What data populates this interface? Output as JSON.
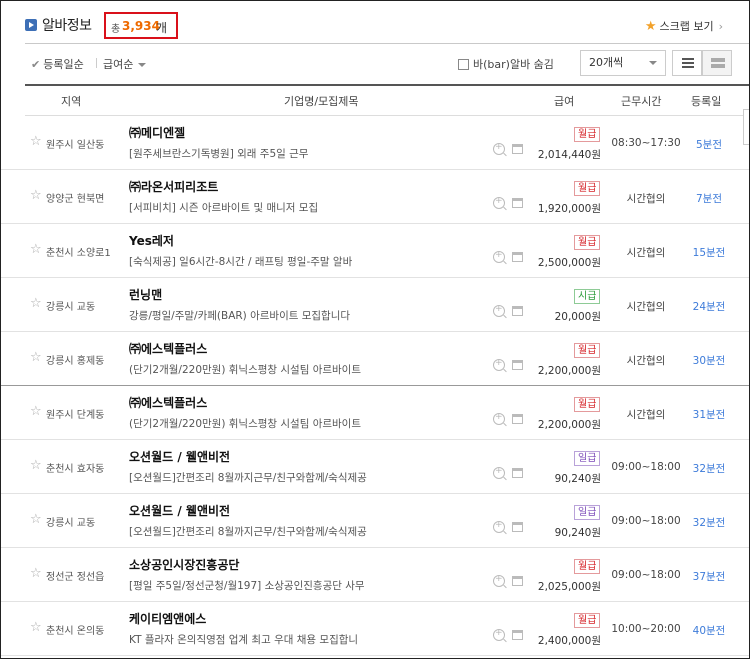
{
  "header": {
    "title": "알바정보",
    "count_prefix": "총",
    "count": "3,934",
    "count_unit": "개",
    "scrap_label": "스크랩 보기"
  },
  "toolbar": {
    "sort_registered": "등록일순",
    "sort_pay": "급여순",
    "bar_hide_label": "바(bar)알바 숨김",
    "per_page": "20개씩"
  },
  "columns": {
    "region": "지역",
    "company_title": "기업명/모집제목",
    "pay": "급여",
    "work_time": "근무시간",
    "registered": "등록일"
  },
  "pay_colors": {
    "월급": "#d6262b",
    "시급": "#2a9b39",
    "일급": "#7c4bb8"
  },
  "rows": [
    {
      "location": "원주시 일산동",
      "company": "㈜메디엔젤",
      "title": "[원주세브란스기독병원] 외래 주5일 근무",
      "pay_type": "월급",
      "pay_kind": "month",
      "pay": "2,014,440원",
      "time": "08:30~17:30",
      "date": "5분전"
    },
    {
      "location": "양양군 현북면",
      "company": "㈜라온서피리조트",
      "title": "[서피비치] 시즌 아르바이트 및 매니저 모집",
      "pay_type": "월급",
      "pay_kind": "month",
      "pay": "1,920,000원",
      "time": "시간협의",
      "date": "7분전"
    },
    {
      "location": "춘천시 소양로1",
      "company": "Yes레저",
      "title": "[숙식제공] 일6시간-8시간 / 래프팅 평일-주말 알바",
      "pay_type": "월급",
      "pay_kind": "month",
      "pay": "2,500,000원",
      "time": "시간협의",
      "date": "15분전"
    },
    {
      "location": "강릉시 교동",
      "company": "런닝맨",
      "title": "강릉/평일/주말/카페(BAR) 아르바이트 모집합니다",
      "pay_type": "시급",
      "pay_kind": "hour",
      "pay": "20,000원",
      "time": "시간협의",
      "date": "24분전"
    },
    {
      "location": "강릉시 홍제동",
      "company": "㈜에스텍플러스",
      "title": "(단기2개월/220만원) 휘닉스평창 시설팀 아르바이트",
      "pay_type": "월급",
      "pay_kind": "month",
      "pay": "2,200,000원",
      "time": "시간협의",
      "date": "30분전"
    },
    {
      "location": "원주시 단계동",
      "company": "㈜에스텍플러스",
      "title": "(단기2개월/220만원) 휘닉스평창 시설팀 아르바이트",
      "pay_type": "월급",
      "pay_kind": "month",
      "pay": "2,200,000원",
      "time": "시간협의",
      "date": "31분전"
    },
    {
      "location": "춘천시 효자동",
      "company": "오션월드 / 웰앤비전",
      "title": "[오션월드]간편조리 8월까지근무/친구와함께/숙식제공",
      "pay_type": "일급",
      "pay_kind": "day",
      "pay": "90,240원",
      "time": "09:00~18:00",
      "date": "32분전"
    },
    {
      "location": "강릉시 교동",
      "company": "오션월드 / 웰앤비전",
      "title": "[오션월드]간편조리 8월까지근무/친구와함께/숙식제공",
      "pay_type": "일급",
      "pay_kind": "day",
      "pay": "90,240원",
      "time": "09:00~18:00",
      "date": "32분전"
    },
    {
      "location": "정선군 정선읍",
      "company": "소상공인시장진흥공단",
      "title": "[평일 주5일/정선군청/월197] 소상공인진흥공단 사무",
      "pay_type": "월급",
      "pay_kind": "month",
      "pay": "2,025,000원",
      "time": "09:00~18:00",
      "date": "37분전"
    },
    {
      "location": "춘천시 온의동",
      "company": "케이티엠앤에스",
      "title": "KT 플라자 온의직영점 업계 최고 우대 채용 모집합니",
      "pay_type": "월급",
      "pay_kind": "month",
      "pay": "2,400,000원",
      "time": "10:00~20:00",
      "date": "40분전"
    }
  ]
}
